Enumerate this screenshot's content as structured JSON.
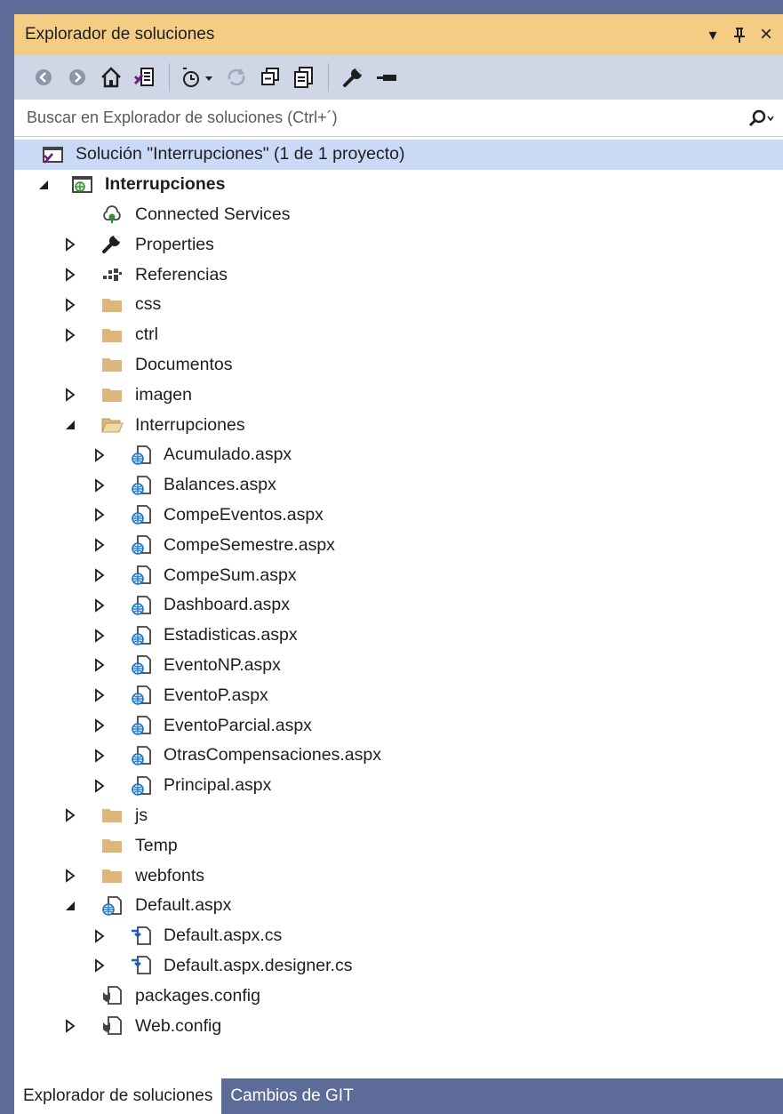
{
  "panel": {
    "title": "Explorador de soluciones",
    "controls": {
      "dropdown": "▾",
      "pin": "pin-icon",
      "close": "×"
    }
  },
  "toolbar": {
    "tools": [
      "back-icon",
      "forward-icon",
      "home-icon",
      "switch-views-icon",
      "pending-changes-filter-icon",
      "sync-icon",
      "collapse-all-icon",
      "show-all-files-icon",
      "properties-icon",
      "preview-icon"
    ]
  },
  "search": {
    "placeholder": "Buscar en Explorador de soluciones (Ctrl+´)"
  },
  "tree": {
    "rows": [
      {
        "label": "Solución \"Interrupciones\" (1 de 1 proyecto)",
        "icon": "solution-icon",
        "level": 0,
        "arrow": "none",
        "selected": true
      },
      {
        "label": "Interrupciones",
        "icon": "web-project-icon",
        "level": 1,
        "arrow": "expanded",
        "bold": true
      },
      {
        "label": "Connected Services",
        "icon": "connected-services-icon",
        "level": 2,
        "arrow": "none"
      },
      {
        "label": "Properties",
        "icon": "wrench-icon",
        "level": 2,
        "arrow": "collapsed"
      },
      {
        "label": "Referencias",
        "icon": "references-icon",
        "level": 2,
        "arrow": "collapsed"
      },
      {
        "label": "css",
        "icon": "folder-icon",
        "level": 2,
        "arrow": "collapsed"
      },
      {
        "label": "ctrl",
        "icon": "folder-icon",
        "level": 2,
        "arrow": "collapsed"
      },
      {
        "label": "Documentos",
        "icon": "folder-icon",
        "level": 2,
        "arrow": "none"
      },
      {
        "label": "imagen",
        "icon": "folder-icon",
        "level": 2,
        "arrow": "collapsed"
      },
      {
        "label": "Interrupciones",
        "icon": "folder-open-icon",
        "level": 2,
        "arrow": "expanded"
      },
      {
        "label": "Acumulado.aspx",
        "icon": "aspx-file-icon",
        "level": 3,
        "arrow": "collapsed"
      },
      {
        "label": "Balances.aspx",
        "icon": "aspx-file-icon",
        "level": 3,
        "arrow": "collapsed"
      },
      {
        "label": "CompeEventos.aspx",
        "icon": "aspx-file-icon",
        "level": 3,
        "arrow": "collapsed"
      },
      {
        "label": "CompeSemestre.aspx",
        "icon": "aspx-file-icon",
        "level": 3,
        "arrow": "collapsed"
      },
      {
        "label": "CompeSum.aspx",
        "icon": "aspx-file-icon",
        "level": 3,
        "arrow": "collapsed"
      },
      {
        "label": "Dashboard.aspx",
        "icon": "aspx-file-icon",
        "level": 3,
        "arrow": "collapsed"
      },
      {
        "label": "Estadisticas.aspx",
        "icon": "aspx-file-icon",
        "level": 3,
        "arrow": "collapsed"
      },
      {
        "label": "EventoNP.aspx",
        "icon": "aspx-file-icon",
        "level": 3,
        "arrow": "collapsed"
      },
      {
        "label": "EventoP.aspx",
        "icon": "aspx-file-icon",
        "level": 3,
        "arrow": "collapsed"
      },
      {
        "label": "EventoParcial.aspx",
        "icon": "aspx-file-icon",
        "level": 3,
        "arrow": "collapsed"
      },
      {
        "label": "OtrasCompensaciones.aspx",
        "icon": "aspx-file-icon",
        "level": 3,
        "arrow": "collapsed"
      },
      {
        "label": "Principal.aspx",
        "icon": "aspx-file-icon",
        "level": 3,
        "arrow": "collapsed"
      },
      {
        "label": "js",
        "icon": "folder-icon",
        "level": 2,
        "arrow": "collapsed"
      },
      {
        "label": "Temp",
        "icon": "folder-icon",
        "level": 2,
        "arrow": "none"
      },
      {
        "label": "webfonts",
        "icon": "folder-icon",
        "level": 2,
        "arrow": "collapsed"
      },
      {
        "label": "Default.aspx",
        "icon": "aspx-file-icon",
        "level": 2,
        "arrow": "expanded"
      },
      {
        "label": "Default.aspx.cs",
        "icon": "cs-file-icon",
        "level": 3,
        "arrow": "collapsed"
      },
      {
        "label": "Default.aspx.designer.cs",
        "icon": "cs-file-icon",
        "level": 3,
        "arrow": "collapsed"
      },
      {
        "label": "packages.config",
        "icon": "config-file-icon",
        "level": 2,
        "arrow": "none"
      },
      {
        "label": "Web.config",
        "icon": "config-file-icon",
        "level": 2,
        "arrow": "collapsed"
      }
    ]
  },
  "bottom_tabs": [
    {
      "label": "Explorador de soluciones",
      "active": true
    },
    {
      "label": "Cambios de GIT",
      "active": false
    }
  ],
  "colors": {
    "accent_title": "#f5cc84",
    "toolbar": "#cfd6e5",
    "selected_row": "#c9d9f6",
    "frame": "#5d6b99",
    "folder": "#dcb67a"
  }
}
